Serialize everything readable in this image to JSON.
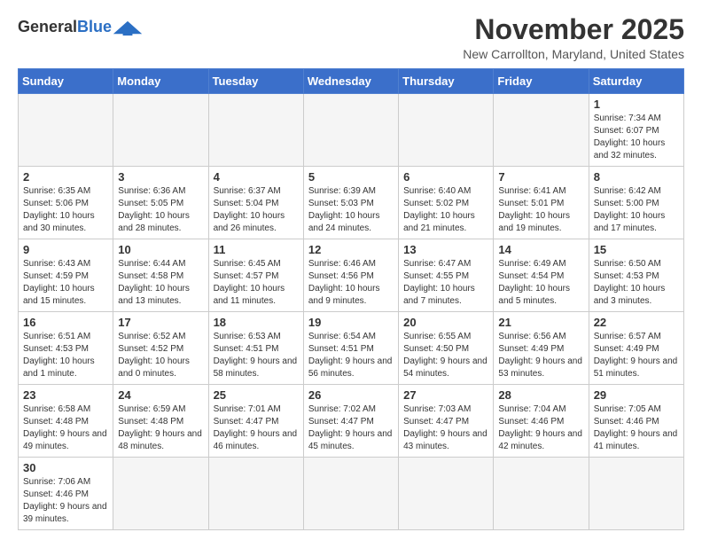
{
  "logo": {
    "general": "General",
    "blue": "Blue"
  },
  "header": {
    "month_year": "November 2025",
    "location": "New Carrollton, Maryland, United States"
  },
  "days_of_week": [
    "Sunday",
    "Monday",
    "Tuesday",
    "Wednesday",
    "Thursday",
    "Friday",
    "Saturday"
  ],
  "weeks": [
    [
      {
        "day": "",
        "info": ""
      },
      {
        "day": "",
        "info": ""
      },
      {
        "day": "",
        "info": ""
      },
      {
        "day": "",
        "info": ""
      },
      {
        "day": "",
        "info": ""
      },
      {
        "day": "",
        "info": ""
      },
      {
        "day": "1",
        "info": "Sunrise: 7:34 AM\nSunset: 6:07 PM\nDaylight: 10 hours and 32 minutes."
      }
    ],
    [
      {
        "day": "2",
        "info": "Sunrise: 6:35 AM\nSunset: 5:06 PM\nDaylight: 10 hours and 30 minutes."
      },
      {
        "day": "3",
        "info": "Sunrise: 6:36 AM\nSunset: 5:05 PM\nDaylight: 10 hours and 28 minutes."
      },
      {
        "day": "4",
        "info": "Sunrise: 6:37 AM\nSunset: 5:04 PM\nDaylight: 10 hours and 26 minutes."
      },
      {
        "day": "5",
        "info": "Sunrise: 6:39 AM\nSunset: 5:03 PM\nDaylight: 10 hours and 24 minutes."
      },
      {
        "day": "6",
        "info": "Sunrise: 6:40 AM\nSunset: 5:02 PM\nDaylight: 10 hours and 21 minutes."
      },
      {
        "day": "7",
        "info": "Sunrise: 6:41 AM\nSunset: 5:01 PM\nDaylight: 10 hours and 19 minutes."
      },
      {
        "day": "8",
        "info": "Sunrise: 6:42 AM\nSunset: 5:00 PM\nDaylight: 10 hours and 17 minutes."
      }
    ],
    [
      {
        "day": "9",
        "info": "Sunrise: 6:43 AM\nSunset: 4:59 PM\nDaylight: 10 hours and 15 minutes."
      },
      {
        "day": "10",
        "info": "Sunrise: 6:44 AM\nSunset: 4:58 PM\nDaylight: 10 hours and 13 minutes."
      },
      {
        "day": "11",
        "info": "Sunrise: 6:45 AM\nSunset: 4:57 PM\nDaylight: 10 hours and 11 minutes."
      },
      {
        "day": "12",
        "info": "Sunrise: 6:46 AM\nSunset: 4:56 PM\nDaylight: 10 hours and 9 minutes."
      },
      {
        "day": "13",
        "info": "Sunrise: 6:47 AM\nSunset: 4:55 PM\nDaylight: 10 hours and 7 minutes."
      },
      {
        "day": "14",
        "info": "Sunrise: 6:49 AM\nSunset: 4:54 PM\nDaylight: 10 hours and 5 minutes."
      },
      {
        "day": "15",
        "info": "Sunrise: 6:50 AM\nSunset: 4:53 PM\nDaylight: 10 hours and 3 minutes."
      }
    ],
    [
      {
        "day": "16",
        "info": "Sunrise: 6:51 AM\nSunset: 4:53 PM\nDaylight: 10 hours and 1 minute."
      },
      {
        "day": "17",
        "info": "Sunrise: 6:52 AM\nSunset: 4:52 PM\nDaylight: 10 hours and 0 minutes."
      },
      {
        "day": "18",
        "info": "Sunrise: 6:53 AM\nSunset: 4:51 PM\nDaylight: 9 hours and 58 minutes."
      },
      {
        "day": "19",
        "info": "Sunrise: 6:54 AM\nSunset: 4:51 PM\nDaylight: 9 hours and 56 minutes."
      },
      {
        "day": "20",
        "info": "Sunrise: 6:55 AM\nSunset: 4:50 PM\nDaylight: 9 hours and 54 minutes."
      },
      {
        "day": "21",
        "info": "Sunrise: 6:56 AM\nSunset: 4:49 PM\nDaylight: 9 hours and 53 minutes."
      },
      {
        "day": "22",
        "info": "Sunrise: 6:57 AM\nSunset: 4:49 PM\nDaylight: 9 hours and 51 minutes."
      }
    ],
    [
      {
        "day": "23",
        "info": "Sunrise: 6:58 AM\nSunset: 4:48 PM\nDaylight: 9 hours and 49 minutes."
      },
      {
        "day": "24",
        "info": "Sunrise: 6:59 AM\nSunset: 4:48 PM\nDaylight: 9 hours and 48 minutes."
      },
      {
        "day": "25",
        "info": "Sunrise: 7:01 AM\nSunset: 4:47 PM\nDaylight: 9 hours and 46 minutes."
      },
      {
        "day": "26",
        "info": "Sunrise: 7:02 AM\nSunset: 4:47 PM\nDaylight: 9 hours and 45 minutes."
      },
      {
        "day": "27",
        "info": "Sunrise: 7:03 AM\nSunset: 4:47 PM\nDaylight: 9 hours and 43 minutes."
      },
      {
        "day": "28",
        "info": "Sunrise: 7:04 AM\nSunset: 4:46 PM\nDaylight: 9 hours and 42 minutes."
      },
      {
        "day": "29",
        "info": "Sunrise: 7:05 AM\nSunset: 4:46 PM\nDaylight: 9 hours and 41 minutes."
      }
    ],
    [
      {
        "day": "30",
        "info": "Sunrise: 7:06 AM\nSunset: 4:46 PM\nDaylight: 9 hours and 39 minutes."
      },
      {
        "day": "",
        "info": ""
      },
      {
        "day": "",
        "info": ""
      },
      {
        "day": "",
        "info": ""
      },
      {
        "day": "",
        "info": ""
      },
      {
        "day": "",
        "info": ""
      },
      {
        "day": "",
        "info": ""
      }
    ]
  ]
}
